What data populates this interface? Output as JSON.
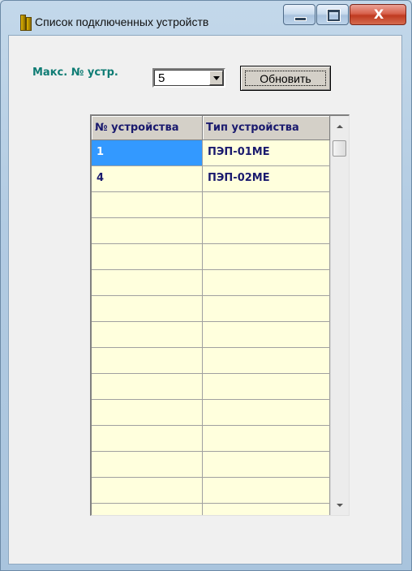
{
  "window": {
    "title": "Список подключенных устройств",
    "close_glyph": "X"
  },
  "toolbar": {
    "max_label": "Макс. № устр.",
    "max_value": "5",
    "refresh_label": "Обновить"
  },
  "grid": {
    "columns": [
      "№ устройства",
      "Тип устройства"
    ],
    "rows": [
      [
        "1",
        "ПЭП-01МЕ"
      ],
      [
        "4",
        "ПЭП-02МЕ"
      ],
      [
        "",
        ""
      ],
      [
        "",
        ""
      ],
      [
        "",
        ""
      ],
      [
        "",
        ""
      ],
      [
        "",
        ""
      ],
      [
        "",
        ""
      ],
      [
        "",
        ""
      ],
      [
        "",
        ""
      ],
      [
        "",
        ""
      ],
      [
        "",
        ""
      ],
      [
        "",
        ""
      ],
      [
        "",
        ""
      ],
      [
        "",
        ""
      ]
    ],
    "selected_row": 0,
    "selected_col": 0
  },
  "colors": {
    "label_accent": "#0f7c74",
    "grid_cell_bg": "#ffffdd",
    "grid_text": "#1a1a6e",
    "selection": "#3399ff"
  }
}
